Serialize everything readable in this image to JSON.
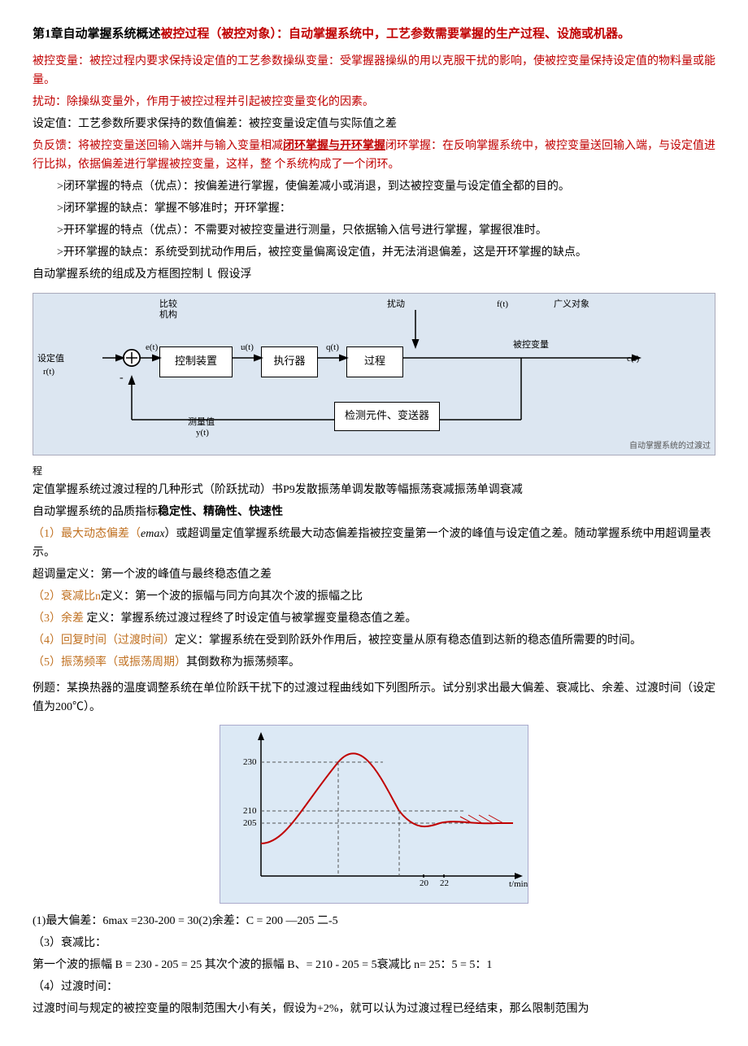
{
  "page": {
    "title_normal": "第1章自动掌握系统概述",
    "title_bold": "被控过程（被控对象）：自动掌握系统中，工艺参数需要掌握的生产过程、设施或机器。",
    "para1": "被控变量：被控过程内要求保持设定值的工艺参数操纵变量：受掌握器操纵的用以克服干扰的影响，使被控变量保持设定值的物料量或能量。",
    "para2": "扰动：除操纵变量外，作用于被控过程并引起被控变量变化的因素。",
    "para3": "设定值：工艺参数所要求保持的数值偏差：被控变量设定值与实际值之差",
    "para4_prefix": "负反馈：将被控变量送回输入端并与输入变量相减",
    "para4_bold": "闭环掌握与开环掌握",
    "para4_suffix": "闭环掌握：在反响掌握系统中，被控变量送回输入端，与设定值进行比拟，依据偏差进行掌握被控变量，这样，整 个系统构成了一个闭环。",
    "indent_items": [
      ">闭环掌握的特点（优点）：按偏差进行掌握，使偏差减小或消退，到达被控变量与设定值全都的目的。",
      ">闭环掌握的缺点：掌握不够准时；开环掌握：",
      ">开环掌握的特点（优点）：不需要对被控变量进行测量，只依据输入信号进行掌握，掌握很准时。",
      ">开环掌握的缺点：系统受到扰动作用后，被控变量偏离设定值，并无法消退偏差，这是开环掌握的缺点。"
    ],
    "para5": "自动掌握系统的组成及方框图控制ｌ 假设浮",
    "diagram_caption": "自动掌握系统的过渡过",
    "diagram_caption2": "程",
    "para6": "定值掌握系统过渡过程的几种形式（阶跃扰动）书P9发散振荡单调发散等幅振荡衰减振荡单调衰减",
    "para7_prefix": "自动掌握系统的品质指标",
    "para7_bold": "稳定性、精确性、快速性",
    "para8_prefix": "（1）最大动态偏差（",
    "para8_italic": "emax",
    "para8_suffix": "）或超调量定值掌握系统最大动态偏差指被控变量第一个波的峰值与设定值之差。随动掌握系统中用超调量表示。",
    "para9": "超调量定义：第一个波的峰值与最终稳态值之差",
    "para10": "（2）衰减比n定义：第一个波的振幅与同方向其次个波的振幅之比",
    "para11": "（3）余差 定义：掌握系统过渡过程终了时设定值与被掌握变量稳态值之差。",
    "para12": "（4）回复时间（过渡时间）定义：掌握系统在受到阶跃外作用后，被控变量从原有稳态值到达新的稳态值所需要的时间。",
    "para13": "（5）振荡频率（或振荡周期）其倒数称为振荡频率。",
    "example_text": "例题：某换热器的温度调整系统在单位阶跃干扰下的过渡过程曲线如下列图所示。试分别求出最大偏差、衰减比、余差、过渡时间（设定值为200℃）。",
    "chart_labels": {
      "y230": "230",
      "y210": "210",
      "y205": "205",
      "x_axis": "t/min",
      "x20": "20",
      "x22": "22"
    },
    "result1": "(1)最大偏差：6max =230-200 = 30(2)余差：C = 200 —205 二-5",
    "result2": "（3）衰减比：",
    "result3": "第一个波的振幅  B = 230 - 205 = 25  其次个波的振幅  B、= 210 - 205 = 5衰减比 n= 25：5 = 5：1",
    "result4": "（4）过渡时间：",
    "result5": "过渡时间与规定的被控变量的限制范围大小有关，假设为+2%，就可以认为过渡过程已经结束，那么限制范围为"
  }
}
